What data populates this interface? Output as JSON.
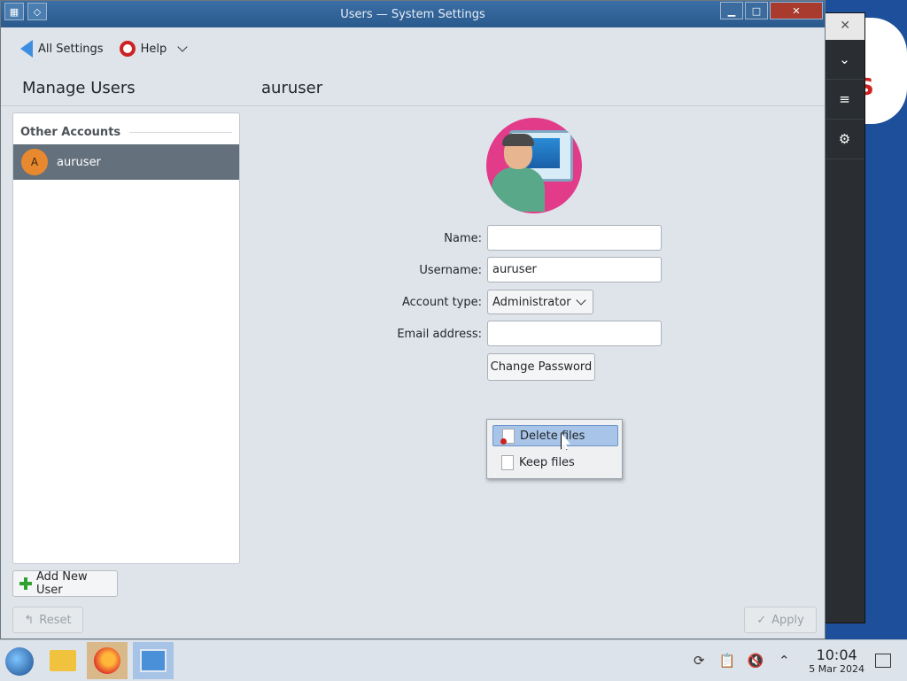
{
  "window": {
    "title": "Users — System Settings"
  },
  "toolbar": {
    "all_settings_label": "All Settings",
    "help_label": "Help"
  },
  "header": {
    "left_title": "Manage Users",
    "right_title": "auruser"
  },
  "accounts": {
    "section_label": "Other Accounts",
    "users": [
      {
        "initial": "A",
        "name": "auruser"
      }
    ]
  },
  "form": {
    "name_label": "Name:",
    "name_value": "",
    "username_label": "Username:",
    "username_value": "auruser",
    "account_type_label": "Account type:",
    "account_type_value": "Administrator",
    "email_label": "Email address:",
    "email_value": "",
    "change_password_label": "Change Password"
  },
  "popup_menu": {
    "items": [
      {
        "label": "Delete files",
        "active": true
      },
      {
        "label": "Keep files",
        "active": false
      }
    ]
  },
  "buttons": {
    "add_user_label": "Add New User",
    "reset_label": "Reset",
    "apply_label": "Apply"
  },
  "taskbar": {
    "time": "10:04",
    "date": "5 Mar 2024"
  },
  "colors": {
    "selection": "#64707c",
    "avatar_bg": "#e23b8a",
    "menu_highlight": "#a8c4e8"
  }
}
